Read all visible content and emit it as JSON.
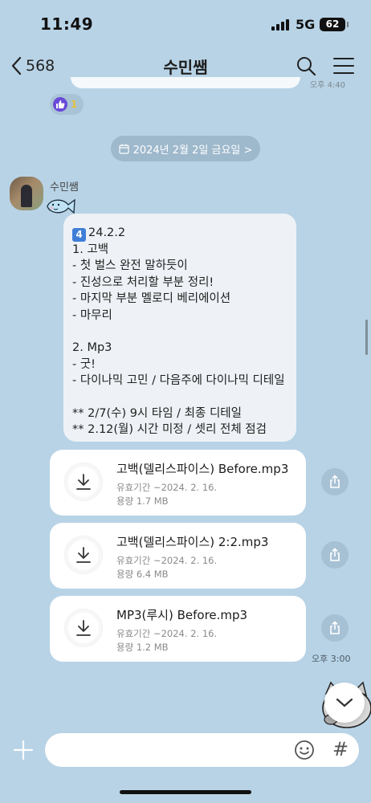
{
  "status_bar": {
    "time": "11:49",
    "network": "5G",
    "battery": "62"
  },
  "header": {
    "back_count": "568",
    "title": "수민쌤"
  },
  "prev_message": {
    "time": "오후 4:40",
    "reaction_count": "1"
  },
  "date_chip": {
    "text": "2024년 2월 2일 금요일 >"
  },
  "sender": {
    "name": "수민쌤"
  },
  "message": {
    "keycap": "4",
    "text": "24.2.2\n1. 고백\n- 첫 벌스 완전 말하듯이\n- 진성으로 처리할 부분 정리!\n- 마지막 부분 멜로디 베리에이션\n- 마무리\n\n2. Mp3\n- 굿!\n- 다이나믹 고민 / 다음주에 다이나믹 디테일\n\n** 2/7(수) 9시 타임 / 최종 디테일\n** 2.12(월) 시간 미정 / 셋리 전체 점검"
  },
  "files": [
    {
      "name": "고백(델리스파이스) Before.mp3",
      "expiry": "유효기간 ~2024. 2. 16.",
      "size": "용량  1.7 MB"
    },
    {
      "name": "고백(델리스파이스) 2:2.mp3",
      "expiry": "유효기간 ~2024. 2. 16.",
      "size": "용량  6.4 MB"
    },
    {
      "name": "MP3(루시) Before.mp3",
      "expiry": "유효기간 ~2024. 2. 16.",
      "size": "용량  1.2 MB"
    }
  ],
  "message_time": "오후 3:00",
  "input": {
    "placeholder": "",
    "hash": "#"
  },
  "icons": [
    "back-chevron-icon",
    "search-icon",
    "menu-icon",
    "thumbs-up-icon",
    "calendar-icon",
    "download-icon",
    "share-icon",
    "chevron-down-icon",
    "plus-icon",
    "emoji-icon"
  ]
}
